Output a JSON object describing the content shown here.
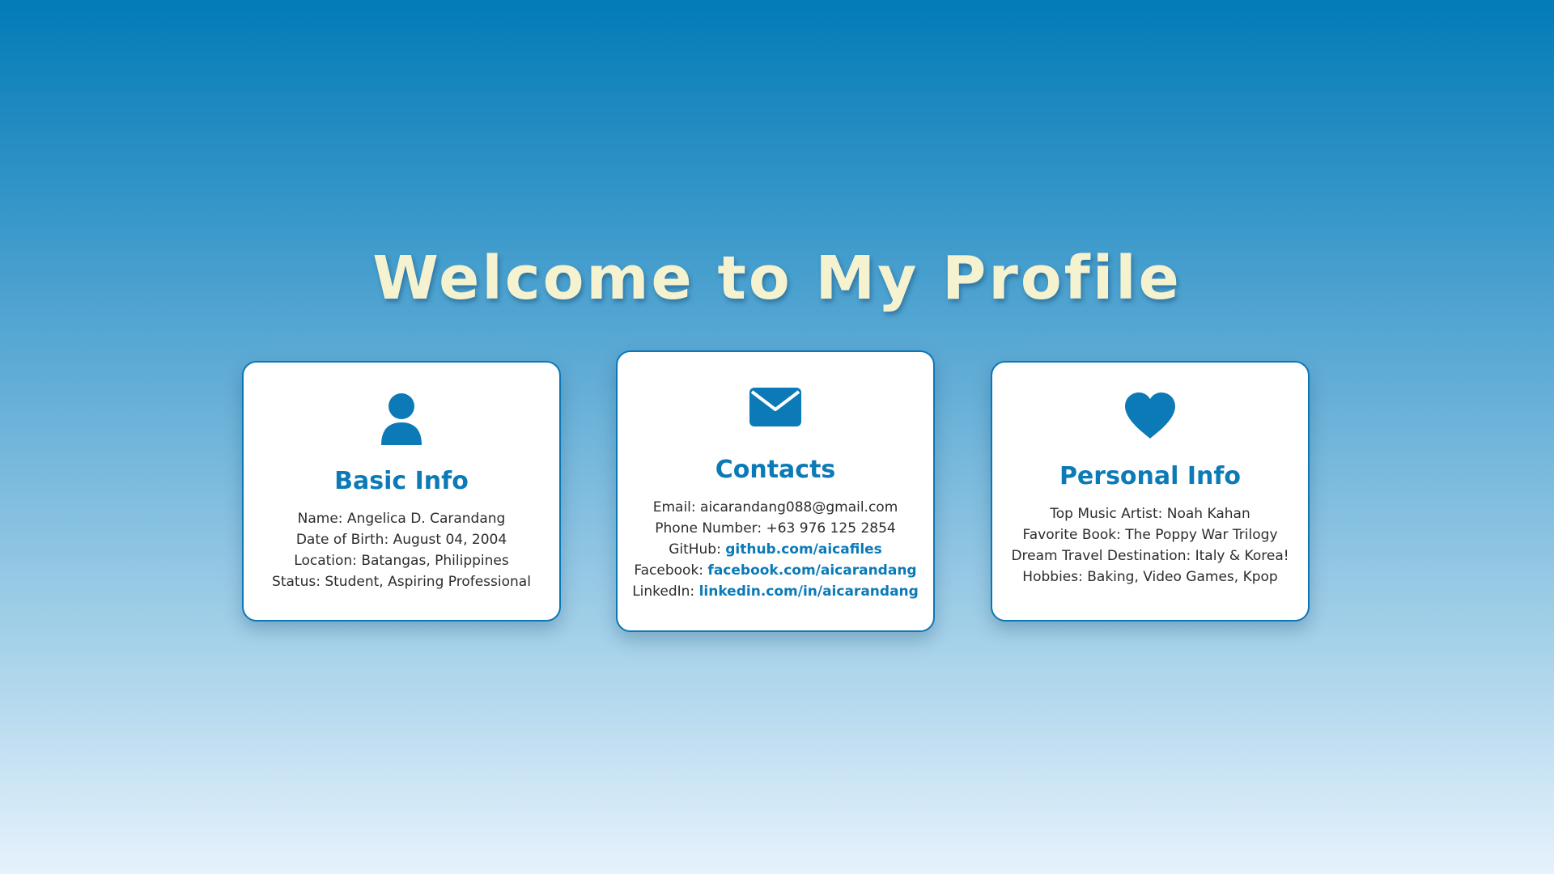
{
  "page": {
    "title": "Welcome to My Profile"
  },
  "colors": {
    "accent": "#0b7ab7",
    "title": "#f5f2cf",
    "card_bg": "#ffffff"
  },
  "cards": {
    "basic": {
      "icon": "user-icon",
      "title": "Basic Info",
      "lines": [
        "Name: Angelica D. Carandang",
        "Date of Birth: August 04, 2004",
        "Location: Batangas, Philippines",
        "Status: Student, Aspiring Professional"
      ]
    },
    "contacts": {
      "icon": "envelope-icon",
      "title": "Contacts",
      "email": "Email: aicarandang088@gmail.com",
      "phone": "Phone Number: +63 976 125 2854",
      "github_label": "GitHub:",
      "github_link": "github.com/aicafiles",
      "facebook_label": "Facebook:",
      "facebook_link": "facebook.com/aicarandang",
      "linkedin_label": "LinkedIn:",
      "linkedin_link": "linkedin.com/in/aicarandang"
    },
    "personal": {
      "icon": "heart-icon",
      "title": "Personal Info",
      "lines": [
        "Top Music Artist: Noah Kahan",
        "Favorite Book: The Poppy War Trilogy",
        "Dream Travel Destination: Italy & Korea!",
        "Hobbies: Baking, Video Games, Kpop"
      ]
    }
  }
}
